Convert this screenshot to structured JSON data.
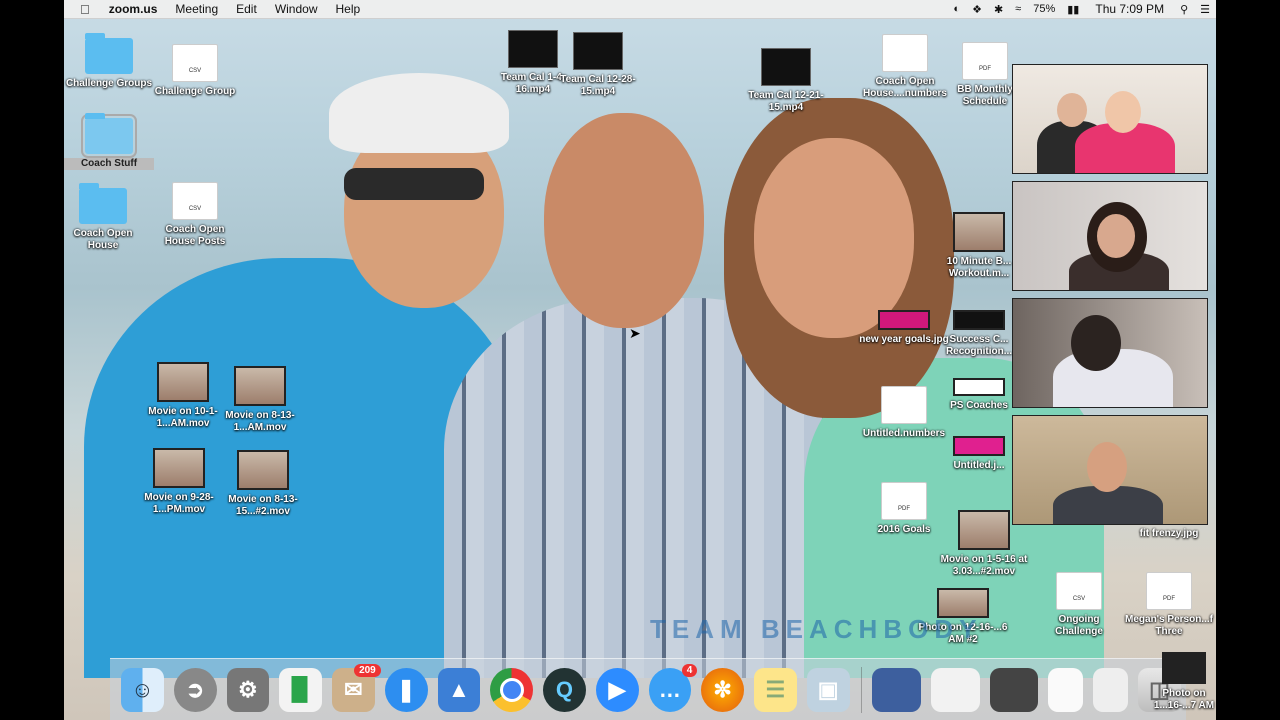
{
  "menubar": {
    "app": "zoom.us",
    "items": [
      "Meeting",
      "Edit",
      "Window",
      "Help"
    ],
    "battery": "75%",
    "clock": "Thu 7:09 PM"
  },
  "desktop_icons": [
    {
      "label": "Challenge Groups",
      "kind": "folder"
    },
    {
      "label": "Challenge Group",
      "kind": "csv",
      "tag": "CSV"
    },
    {
      "label": "Coach Stuff",
      "kind": "folder"
    },
    {
      "label": "Coach Open House",
      "kind": "folder"
    },
    {
      "label": "Coach Open House Posts",
      "kind": "csv",
      "tag": "CSV"
    },
    {
      "label": "Team Cal 1-4-16.mp4",
      "kind": "video"
    },
    {
      "label": "Team Cal 12-28-15.mp4",
      "kind": "video"
    },
    {
      "label": "Team Cal 12-21-15.mp4",
      "kind": "video"
    },
    {
      "label": "Coach Open House....numbers",
      "kind": "doc"
    },
    {
      "label": "BB Monthly Schedule",
      "kind": "pdf",
      "tag": "PDF"
    },
    {
      "label": "10 Minute B... Workout.m...",
      "kind": "thumb"
    },
    {
      "label": "new year goals.jpg",
      "kind": "thumb"
    },
    {
      "label": "Success C... Recognition...",
      "kind": "thumb"
    },
    {
      "label": "Untitled.numbers",
      "kind": "doc"
    },
    {
      "label": "PS Coaches",
      "kind": "thumb"
    },
    {
      "label": "Untitled.j...",
      "kind": "thumb"
    },
    {
      "label": "2016 Goals",
      "kind": "pdf",
      "tag": "PDF"
    },
    {
      "label": "Movie on 1-5-16 at 3.03...#2.mov",
      "kind": "thumb"
    },
    {
      "label": "fit frenzy.jpg",
      "kind": "thumb"
    },
    {
      "label": "Photo on 12-16-...6 AM #2",
      "kind": "thumb"
    },
    {
      "label": "Ongoing Challenge",
      "kind": "csv",
      "tag": "CSV"
    },
    {
      "label": "Megan's Person...f Three",
      "kind": "pdf",
      "tag": "PDF"
    },
    {
      "label": "Movie on 10-1-1...AM.mov",
      "kind": "thumb"
    },
    {
      "label": "Movie on 8-13-1...AM.mov",
      "kind": "thumb"
    },
    {
      "label": "Movie on 9-28-1...PM.mov",
      "kind": "thumb"
    },
    {
      "label": "Movie on 8-13-15...#2.mov",
      "kind": "thumb"
    },
    {
      "label": "Photo on 1...16-...7 AM",
      "kind": "thumb"
    }
  ],
  "watermark": "TEAM BEACHBODY",
  "zoom_tiles": [
    "participant-1",
    "participant-2",
    "participant-3",
    "participant-4"
  ],
  "dock": {
    "mail_badge": "209",
    "messages_badge": "4",
    "apps": [
      "finder-icon",
      "launchpad-icon",
      "system-preferences-icon",
      "numbers-icon",
      "mail-icon",
      "safari-icon",
      "keynote-icon",
      "chrome-icon",
      "quicktime-icon",
      "zoom-icon",
      "messages-icon",
      "firefox-icon",
      "notes-icon",
      "preview-icon"
    ]
  }
}
